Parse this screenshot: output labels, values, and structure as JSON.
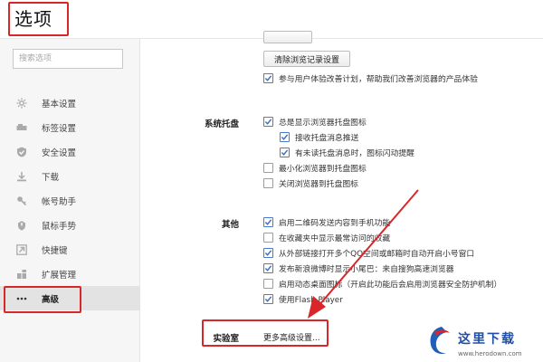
{
  "header": {
    "title": "选项"
  },
  "sidebar": {
    "search_placeholder": "搜索选项",
    "items": [
      {
        "label": "基本设置",
        "icon": "gear-icon"
      },
      {
        "label": "标签设置",
        "icon": "tab-icon"
      },
      {
        "label": "安全设置",
        "icon": "shield-check-icon"
      },
      {
        "label": "下载",
        "icon": "download-icon"
      },
      {
        "label": "帐号助手",
        "icon": "key-icon"
      },
      {
        "label": "鼠标手势",
        "icon": "mouse-gesture-icon"
      },
      {
        "label": "快捷键",
        "icon": "shortcut-arrow-icon"
      },
      {
        "label": "扩展管理",
        "icon": "extension-icon"
      },
      {
        "label": "高级",
        "icon": "more-dots-icon",
        "active": true
      }
    ]
  },
  "privacy": {
    "clear_button": "清除浏览记录设置",
    "checkbox": {
      "label": "参与用户体验改善计划，帮助我们改善浏览器的产品体验",
      "checked": true
    }
  },
  "tray": {
    "title": "系统托盘",
    "options": [
      {
        "label": "总是显示浏览器托盘图标",
        "checked": true
      },
      {
        "label": "接收托盘消息推送",
        "checked": true
      },
      {
        "label": "有未读托盘消息时，图标闪动提醒",
        "checked": true
      },
      {
        "label": "最小化浏览器到托盘图标",
        "checked": false
      },
      {
        "label": "关闭浏览器到托盘图标",
        "checked": false
      }
    ]
  },
  "other": {
    "title": "其他",
    "options": [
      {
        "label": "启用二维码发送内容到手机功能",
        "checked": true
      },
      {
        "label": "在收藏夹中显示最常访问的收藏",
        "checked": false
      },
      {
        "label": "从外部链接打开多个QQ空间或邮箱时自动开启小号窗口",
        "checked": true
      },
      {
        "label": "发布新浪微博时显示小尾巴：来自搜狗高速浏览器",
        "checked": true
      },
      {
        "label": "启用动态桌面图标（开启此功能后会启用浏览器安全防护机制）",
        "checked": false
      },
      {
        "label": "使用Flash Player",
        "checked": true
      }
    ]
  },
  "lab": {
    "title": "实验室",
    "link": "更多高级设置..."
  },
  "watermark": {
    "name": "这里下载",
    "url": "www.herodown.com"
  },
  "colors": {
    "highlight_red": "#d9262a",
    "checkbox_blue": "#4a7bd0"
  }
}
